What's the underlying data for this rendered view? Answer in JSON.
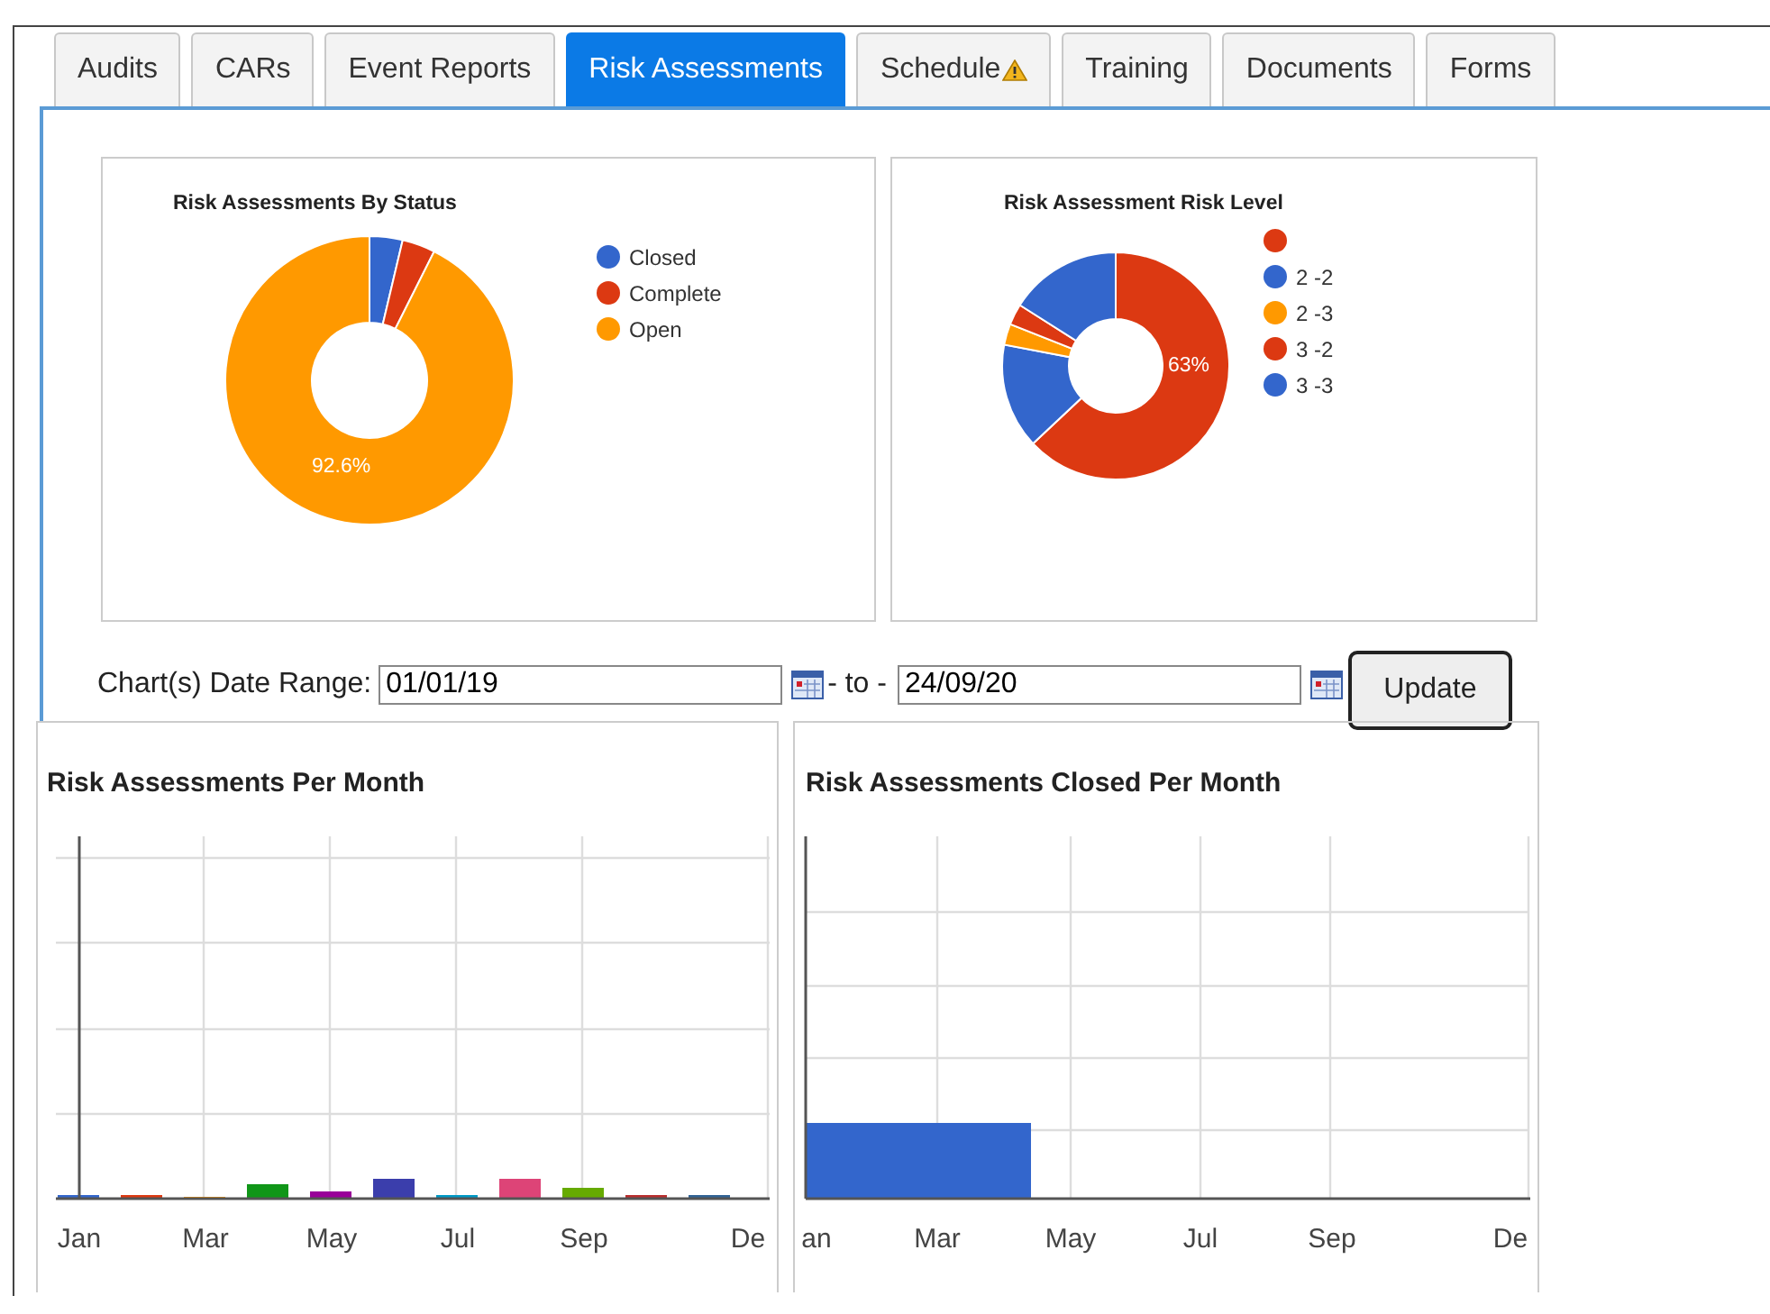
{
  "tabs": [
    {
      "label": "Audits",
      "selected": false,
      "warning": false
    },
    {
      "label": "CARs",
      "selected": false,
      "warning": false
    },
    {
      "label": "Event Reports",
      "selected": false,
      "warning": false
    },
    {
      "label": "Risk Assessments",
      "selected": true,
      "warning": false
    },
    {
      "label": "Schedule",
      "selected": false,
      "warning": true
    },
    {
      "label": "Training",
      "selected": false,
      "warning": false
    },
    {
      "label": "Documents",
      "selected": false,
      "warning": false
    },
    {
      "label": "Forms",
      "selected": false,
      "warning": false
    }
  ],
  "status_chart": {
    "title": "Risk Assessments By Status",
    "slice_label": "92.6%",
    "legend": [
      {
        "label": "Closed",
        "color": "#3366cc"
      },
      {
        "label": "Complete",
        "color": "#dc3912"
      },
      {
        "label": "Open",
        "color": "#ff9900"
      }
    ]
  },
  "level_chart": {
    "title": "Risk Assessment Risk Level",
    "slice_label": "63%",
    "legend": [
      {
        "color": "#dc3912"
      },
      {
        "label": "2 -2",
        "color": "#3366cc"
      },
      {
        "label": "2 -3",
        "color": "#ff9900"
      },
      {
        "label": "3 -2",
        "color": "#dc3912"
      },
      {
        "label": "3 -3",
        "color": "#3366cc"
      }
    ]
  },
  "date_range": {
    "label": "Chart(s) Date Range:",
    "from": "01/01/19",
    "separator": "- to -",
    "to": "24/09/20",
    "button": "Update"
  },
  "monthly_chart": {
    "title": "Risk Assessments Per Month",
    "x_labels": [
      "Jan",
      "Mar",
      "May",
      "Jul",
      "Sep",
      "De"
    ]
  },
  "closed_chart": {
    "title": "Risk Assessments Closed Per Month",
    "x_labels": [
      "an",
      "Mar",
      "May",
      "Jul",
      "Sep",
      "De"
    ]
  }
}
